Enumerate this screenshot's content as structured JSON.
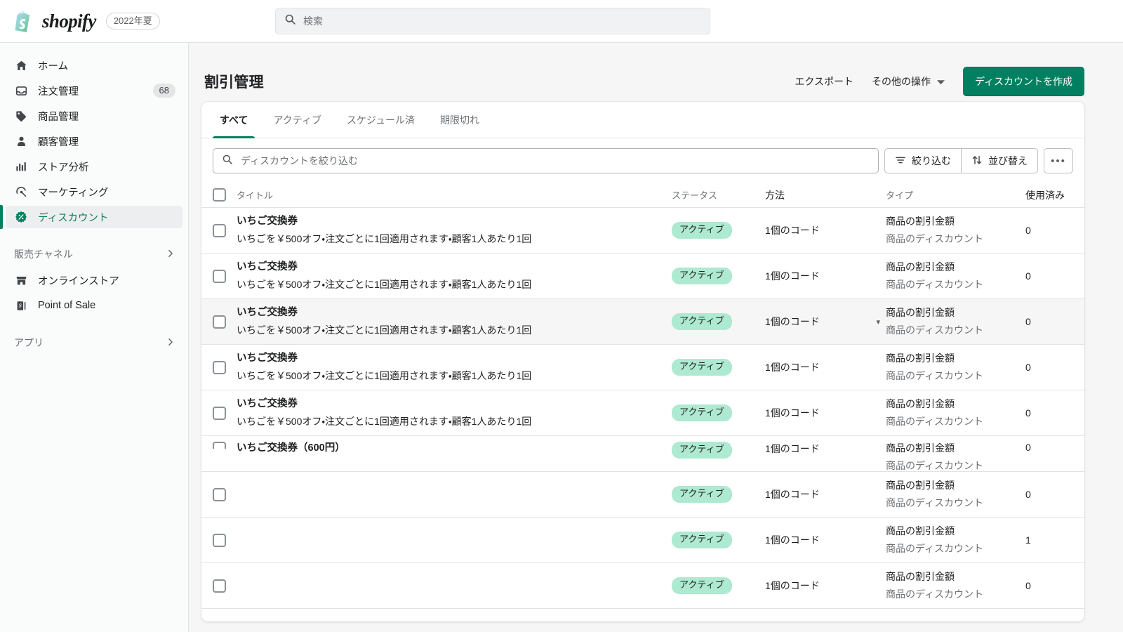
{
  "topbar": {
    "brand_name": "shopify",
    "season_badge": "2022年夏",
    "search_placeholder": "検索",
    "search_value": "",
    "search_icon": "search-icon"
  },
  "sidebar": {
    "items": [
      {
        "label": "ホーム",
        "icon": "home-icon",
        "badge": "",
        "active": false
      },
      {
        "label": "注文管理",
        "icon": "orders-icon",
        "badge": "68",
        "active": false
      },
      {
        "label": "商品管理",
        "icon": "products-icon",
        "badge": "",
        "active": false
      },
      {
        "label": "顧客管理",
        "icon": "customers-icon",
        "badge": "",
        "active": false
      },
      {
        "label": "ストア分析",
        "icon": "analytics-icon",
        "badge": "",
        "active": false
      },
      {
        "label": "マーケティング",
        "icon": "marketing-icon",
        "badge": "",
        "active": false
      },
      {
        "label": "ディスカウント",
        "icon": "discount-icon",
        "badge": "",
        "active": true
      }
    ],
    "sections": [
      {
        "label": "販売チャネル",
        "icon": "chevron-right-icon"
      },
      {
        "label": "アプリ",
        "icon": "chevron-right-icon"
      }
    ],
    "channels": [
      {
        "label": "オンラインストア",
        "icon": "storefront-icon"
      },
      {
        "label": "Point of Sale",
        "icon": "pos-icon"
      }
    ]
  },
  "page": {
    "title": "割引管理",
    "export_label": "エクスポート",
    "more_actions_label": "その他の操作",
    "more_actions_icon": "caret-down-icon",
    "create_label": "ディスカウントを作成"
  },
  "tabs": [
    {
      "label": "すべて",
      "active": true
    },
    {
      "label": "アクティブ",
      "active": false
    },
    {
      "label": "スケジュール済",
      "active": false
    },
    {
      "label": "期限切れ",
      "active": false
    }
  ],
  "filterbar": {
    "search_icon": "search-icon",
    "search_placeholder": "ディスカウントを絞り込む",
    "search_value": "",
    "filter_label": "絞り込む",
    "filter_icon": "filter-icon",
    "sort_label": "並び替え",
    "sort_icon": "sort-arrows-icon",
    "more_label": "•••",
    "more_icon": "ellipsis-icon"
  },
  "table": {
    "columns": {
      "select_icon": "checkbox-icon",
      "title": "タイトル",
      "status": "ステータス",
      "method": "方法",
      "type": "タイプ",
      "used": "使用済み"
    },
    "rows": [
      {
        "title": "いちご交換券",
        "subtitle": "いちごを￥500オフ・注文ごとに1回適用されます・顧客1人あたり1回",
        "status": "アクティブ",
        "method": "1個のコード",
        "type_main": "商品の割引金額",
        "type_sub": "商品のディスカウント",
        "used": "0",
        "hovered": false,
        "caret": ""
      },
      {
        "title": "いちご交換券",
        "subtitle": "いちごを￥500オフ・注文ごとに1回適用されます・顧客1人あたり1回",
        "status": "アクティブ",
        "method": "1個のコード",
        "type_main": "商品の割引金額",
        "type_sub": "商品のディスカウント",
        "used": "0",
        "hovered": false,
        "caret": ""
      },
      {
        "title": "いちご交換券",
        "subtitle": "いちごを￥500オフ・注文ごとに1回適用されます・顧客1人あたり1回",
        "status": "アクティブ",
        "method": "1個のコード",
        "type_main": "商品の割引金額",
        "type_sub": "商品のディスカウント",
        "used": "0",
        "hovered": true,
        "caret": "▾"
      },
      {
        "title": "いちご交換券",
        "subtitle": "いちごを￥500オフ・注文ごとに1回適用されます・顧客1人あたり1回",
        "status": "アクティブ",
        "method": "1個のコード",
        "type_main": "商品の割引金額",
        "type_sub": "商品のディスカウント",
        "used": "0",
        "hovered": false,
        "caret": ""
      },
      {
        "title": "いちご交換券",
        "subtitle": "いちごを￥500オフ・注文ごとに1回適用されます・顧客1人あたり1回",
        "status": "アクティブ",
        "method": "1個のコード",
        "type_main": "商品の割引金額",
        "type_sub": "商品のディスカウント",
        "used": "0",
        "hovered": false,
        "caret": ""
      },
      {
        "title": "いちご交換券（600円）",
        "subtitle": "",
        "status": "アクティブ",
        "method": "1個のコード",
        "type_main": "商品の割引金額",
        "type_sub": "商品のディスカウント",
        "used": "0",
        "hovered": false,
        "caret": ""
      },
      {
        "title": "",
        "subtitle": "",
        "status": "アクティブ",
        "method": "1個のコード",
        "type_main": "商品の割引金額",
        "type_sub": "商品のディスカウント",
        "used": "0",
        "hovered": false,
        "caret": ""
      },
      {
        "title": "",
        "subtitle": "",
        "status": "アクティブ",
        "method": "1個のコード",
        "type_main": "商品の割引金額",
        "type_sub": "商品のディスカウント",
        "used": "1",
        "hovered": false,
        "caret": ""
      },
      {
        "title": "",
        "subtitle": "",
        "status": "アクティブ",
        "method": "1個のコード",
        "type_main": "商品の割引金額",
        "type_sub": "商品のディスカウント",
        "used": "0",
        "hovered": false,
        "caret": ""
      }
    ]
  },
  "colors": {
    "brand_green": "#008060",
    "accent_green": "#0e7d5a",
    "badge_green": "#aee9d1",
    "page_bg": "#f6f6f7",
    "sidebar_bg": "#fafbfb",
    "border": "#e1e3e5"
  }
}
